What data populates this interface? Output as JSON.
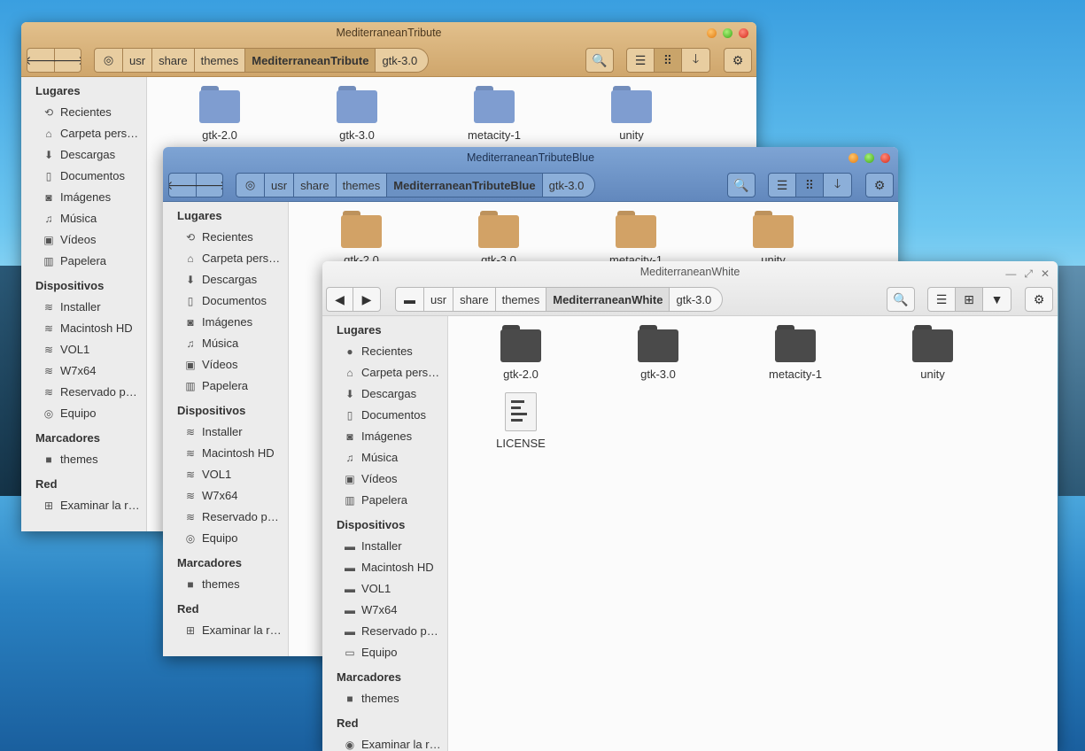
{
  "w1": {
    "title": "MediterraneanTribute",
    "crumbs": [
      "usr",
      "share",
      "themes",
      "MediterraneanTribute",
      "gtk-3.0"
    ],
    "sidebar": [
      {
        "h": "Lugares"
      },
      {
        "i": "Recientes",
        "icon": "⟲"
      },
      {
        "i": "Carpeta pers…",
        "icon": "⌂"
      },
      {
        "i": "Descargas",
        "icon": "⬇"
      },
      {
        "i": "Documentos",
        "icon": "▯"
      },
      {
        "i": "Imágenes",
        "icon": "◙"
      },
      {
        "i": "Música",
        "icon": "♫"
      },
      {
        "i": "Vídeos",
        "icon": "▣"
      },
      {
        "i": "Papelera",
        "icon": "▥"
      },
      {
        "h": "Dispositivos"
      },
      {
        "i": "Installer",
        "icon": "≋"
      },
      {
        "i": "Macintosh HD",
        "icon": "≋"
      },
      {
        "i": "VOL1",
        "icon": "≋"
      },
      {
        "i": "W7x64",
        "icon": "≋"
      },
      {
        "i": "Reservado p…",
        "icon": "≋"
      },
      {
        "i": "Equipo",
        "icon": "◎"
      },
      {
        "h": "Marcadores"
      },
      {
        "i": "themes",
        "icon": "■"
      },
      {
        "h": "Red"
      },
      {
        "i": "Examinar la r…",
        "icon": "⊞"
      }
    ],
    "items": [
      "gtk-2.0",
      "gtk-3.0",
      "metacity-1",
      "unity"
    ]
  },
  "w2": {
    "title": "MediterraneanTributeBlue",
    "crumbs": [
      "usr",
      "share",
      "themes",
      "MediterraneanTributeBlue",
      "gtk-3.0"
    ],
    "sidebar": [
      {
        "h": "Lugares"
      },
      {
        "i": "Recientes",
        "icon": "⟲"
      },
      {
        "i": "Carpeta pers…",
        "icon": "⌂"
      },
      {
        "i": "Descargas",
        "icon": "⬇"
      },
      {
        "i": "Documentos",
        "icon": "▯"
      },
      {
        "i": "Imágenes",
        "icon": "◙"
      },
      {
        "i": "Música",
        "icon": "♫"
      },
      {
        "i": "Vídeos",
        "icon": "▣"
      },
      {
        "i": "Papelera",
        "icon": "▥"
      },
      {
        "h": "Dispositivos"
      },
      {
        "i": "Installer",
        "icon": "≋"
      },
      {
        "i": "Macintosh HD",
        "icon": "≋"
      },
      {
        "i": "VOL1",
        "icon": "≋"
      },
      {
        "i": "W7x64",
        "icon": "≋"
      },
      {
        "i": "Reservado p…",
        "icon": "≋"
      },
      {
        "i": "Equipo",
        "icon": "◎"
      },
      {
        "h": "Marcadores"
      },
      {
        "i": "themes",
        "icon": "■"
      },
      {
        "h": "Red"
      },
      {
        "i": "Examinar la r…",
        "icon": "⊞"
      }
    ],
    "items": [
      "gtk-2.0",
      "gtk-3.0",
      "metacity-1",
      "unity"
    ]
  },
  "w3": {
    "title": "MediterraneanWhite",
    "crumbs": [
      "usr",
      "share",
      "themes",
      "MediterraneanWhite",
      "gtk-3.0"
    ],
    "sidebar": [
      {
        "h": "Lugares"
      },
      {
        "i": "Recientes",
        "icon": "●"
      },
      {
        "i": "Carpeta pers…",
        "icon": "⌂"
      },
      {
        "i": "Descargas",
        "icon": "⬇"
      },
      {
        "i": "Documentos",
        "icon": "▯"
      },
      {
        "i": "Imágenes",
        "icon": "◙"
      },
      {
        "i": "Música",
        "icon": "♫"
      },
      {
        "i": "Vídeos",
        "icon": "▣"
      },
      {
        "i": "Papelera",
        "icon": "▥"
      },
      {
        "h": "Dispositivos"
      },
      {
        "i": "Installer",
        "icon": "▬"
      },
      {
        "i": "Macintosh HD",
        "icon": "▬"
      },
      {
        "i": "VOL1",
        "icon": "▬"
      },
      {
        "i": "W7x64",
        "icon": "▬"
      },
      {
        "i": "Reservado p…",
        "icon": "▬"
      },
      {
        "i": "Equipo",
        "icon": "▭"
      },
      {
        "h": "Marcadores"
      },
      {
        "i": "themes",
        "icon": "■"
      },
      {
        "h": "Red"
      },
      {
        "i": "Examinar la r…",
        "icon": "◉"
      }
    ],
    "items": [
      "gtk-2.0",
      "gtk-3.0",
      "metacity-1",
      "unity",
      "LICENSE"
    ]
  },
  "colors": {
    "w1_bar": "#d9b47d",
    "w1_folder": "#7f9dd0",
    "w2_bar": "#6f97c9",
    "w2_folder": "#d2a266",
    "w3_bar": "#ececec",
    "w3_folder": "#4a4a4a"
  }
}
